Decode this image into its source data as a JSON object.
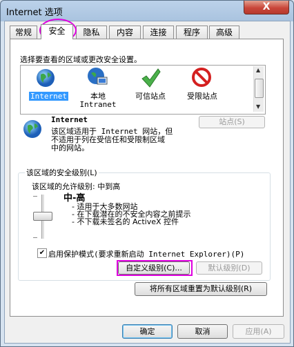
{
  "window": {
    "title": "Internet 选项",
    "close_glyph": "X"
  },
  "tabs": [
    {
      "label": "常规"
    },
    {
      "label": "安全"
    },
    {
      "label": "隐私"
    },
    {
      "label": "内容"
    },
    {
      "label": "连接"
    },
    {
      "label": "程序"
    },
    {
      "label": "高级"
    }
  ],
  "zones": {
    "prompt": "选择要查看的区域或更改安全设置。",
    "items": [
      {
        "name": "Internet",
        "subname": "",
        "icon": "globe-icon"
      },
      {
        "name": "本地",
        "subname": "Intranet",
        "icon": "local-intranet-icon"
      },
      {
        "name": "可信站点",
        "subname": "",
        "icon": "checkmark-icon"
      },
      {
        "name": "受限站点",
        "subname": "",
        "icon": "restricted-icon"
      }
    ],
    "sites_button": "站点(S)"
  },
  "zone_detail": {
    "name": "Internet",
    "description_lines": [
      "该区域适用于 Internet 网站，但",
      "不适用于列在受信任和受限制区域",
      "中的网站。"
    ]
  },
  "security_level": {
    "group_label": "该区域的安全级别(L)",
    "allowed": "该区域的允许级别: 中到高",
    "level_name": "中-高",
    "bullets": [
      "- 适用于大多数网站",
      "- 在下载潜在的不安全内容之前提示",
      "- 不下载未签名的 ActiveX 控件"
    ],
    "protected_mode_label": "启用保护模式(要求重新启动 Internet Explorer)(P)",
    "protected_mode_checked": true,
    "custom_button": "自定义级别(C)...",
    "default_button": "默认级别(D)",
    "reset_all_button": "将所有区域重置为默认级别(R)"
  },
  "footer": {
    "ok": "确定",
    "cancel": "取消",
    "apply": "应用(A)"
  },
  "colors": {
    "highlight": "#e000e0",
    "selection": "#3399ff"
  }
}
